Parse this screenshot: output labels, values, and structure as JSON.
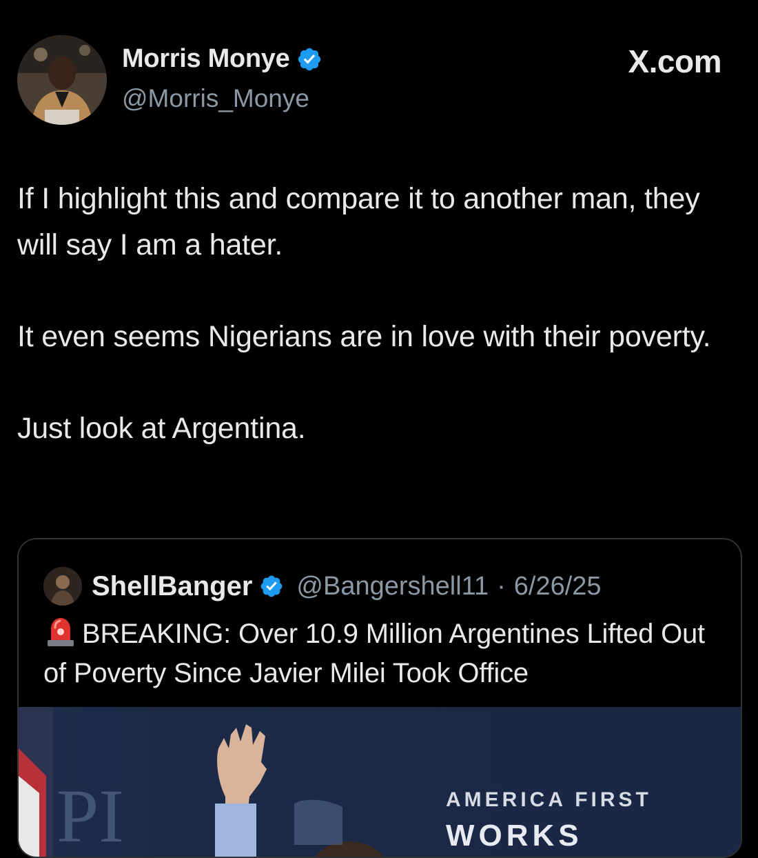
{
  "author": {
    "display_name": "Morris Monye",
    "handle": "@Morris_Monye",
    "verified_color": "#1d9bf0"
  },
  "site_label": "X.com",
  "tweet": {
    "paragraphs": [
      "If I highlight this and compare it to another man, they will say I am a hater.",
      "It even seems Nigerians are in love with their poverty.",
      "Just look at Argentina."
    ]
  },
  "quoted_tweet": {
    "display_name": "ShellBanger",
    "handle": "@Bangershell11",
    "separator": "·",
    "date": "6/26/25",
    "siren_icon": "police-siren-emoji",
    "text": "BREAKING: Over 10.9 Million Argentines Lifted Out of Poverty Since Javier Milei Took Office",
    "media": {
      "banner_text": "AMERICA FIRST",
      "banner_sub": "WORKS",
      "backdrop_letters": "PI"
    }
  },
  "colors": {
    "background": "#000000",
    "text_primary": "#e7e9ea",
    "text_secondary": "#8b98a5",
    "border": "#2f3336",
    "verified": "#1d9bf0"
  }
}
